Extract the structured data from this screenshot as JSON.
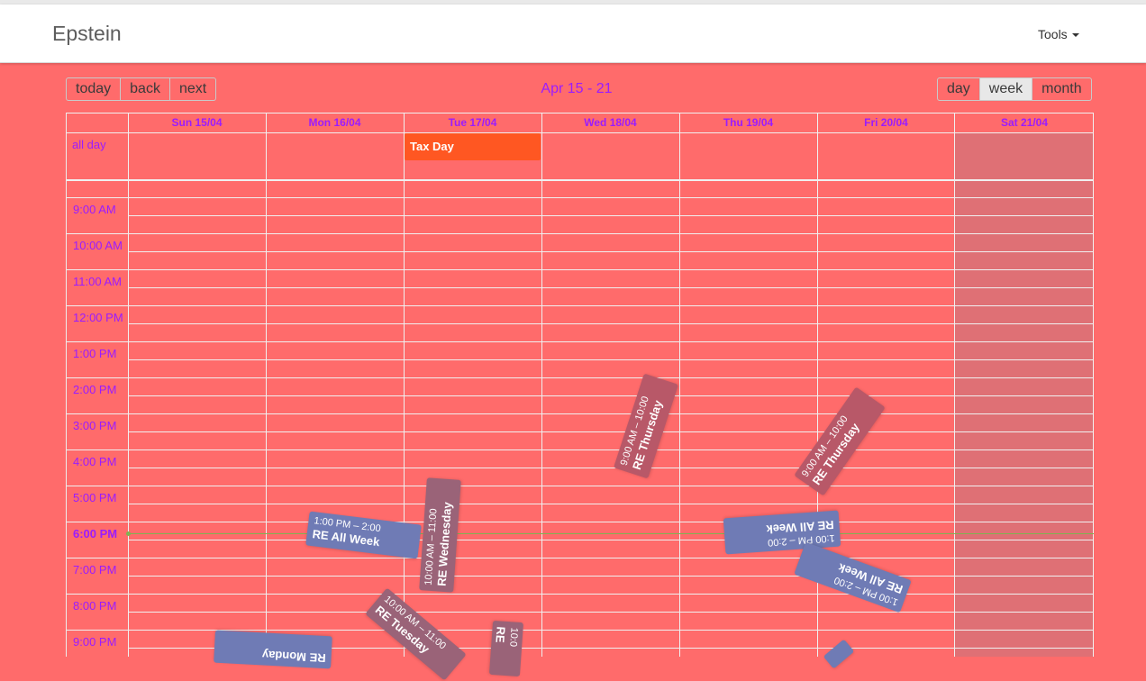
{
  "app": {
    "brand": "Epstein",
    "tools_label": "Tools"
  },
  "toolbar": {
    "nav": [
      "today",
      "back",
      "next"
    ],
    "title": "Apr 15 - 21",
    "views": [
      "day",
      "week",
      "month"
    ],
    "active_view": "week"
  },
  "calendar": {
    "days": [
      "Sun 15/04",
      "Mon 16/04",
      "Tue 17/04",
      "Wed 18/04",
      "Thu 19/04",
      "Fri 20/04",
      "Sat 21/04"
    ],
    "all_day_label": "all day",
    "all_day_event": "Tax Day",
    "times": [
      "9:00 AM",
      "10:00 AM",
      "11:00 AM",
      "12:00 PM",
      "1:00 PM",
      "2:00 PM",
      "3:00 PM",
      "4:00 PM",
      "5:00 PM",
      "6:00 PM",
      "7:00 PM",
      "8:00 PM",
      "9:00 PM"
    ],
    "current_time_label": "6:00 PM",
    "events": [
      {
        "time": "9:00 AM – 10:00",
        "title": "RE Thursday"
      },
      {
        "time": "9:00 AM – 10:00",
        "title": "RE Thursday"
      },
      {
        "time": "1:00 PM – 2:00",
        "title": "RE All Week"
      },
      {
        "time": "10:00 AM – 11:00",
        "title": "RE Wednesday"
      },
      {
        "time": "1:00 PM – 2:00",
        "title": "RE All Week"
      },
      {
        "time": "1:00 PM – 2:00",
        "title": "RE All Week"
      },
      {
        "time": "10:00 AM – 11:00",
        "title": "RE Tuesday"
      },
      {
        "time": "10:0",
        "title": "RE"
      },
      {
        "time": "",
        "title": "RE Monday"
      }
    ]
  },
  "colors": {
    "background": "#ff6b6b",
    "accent_text": "#9b1cff",
    "tax_day": "#ff5722",
    "event_mauve": "#b85868",
    "event_blue": "#6f7bb5",
    "now_indicator": "#7fb352",
    "saturday_shade": "#df7075"
  }
}
